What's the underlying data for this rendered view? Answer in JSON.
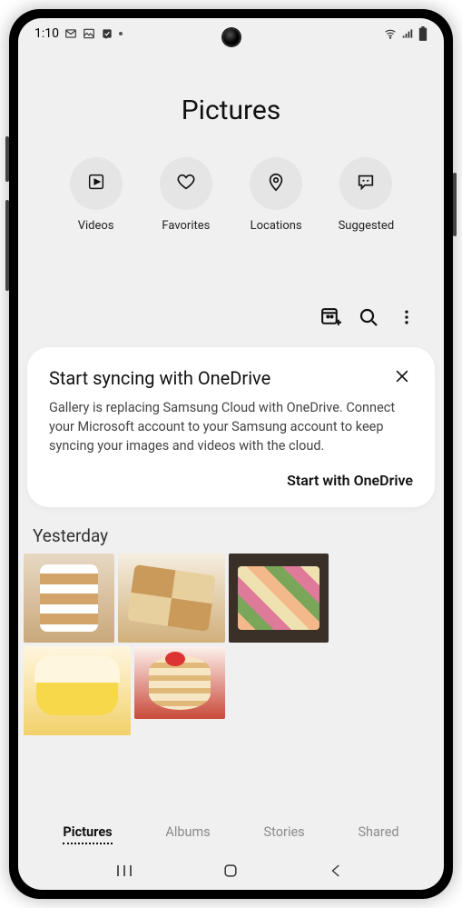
{
  "status": {
    "time": "1:10",
    "icons_left": [
      "gmail-icon",
      "image-icon",
      "check-icon"
    ],
    "icons_right": [
      "wifi-icon",
      "signal-icon",
      "battery-icon"
    ]
  },
  "header": {
    "title": "Pictures",
    "shortcuts": [
      {
        "icon": "play-icon",
        "label": "Videos"
      },
      {
        "icon": "heart-icon",
        "label": "Favorites"
      },
      {
        "icon": "pin-icon",
        "label": "Locations"
      },
      {
        "icon": "bubble-icon",
        "label": "Suggested"
      }
    ]
  },
  "actions": {
    "create": "create-gif-icon",
    "search": "search-icon",
    "more": "more-icon"
  },
  "card": {
    "title": "Start syncing with OneDrive",
    "body": "Gallery is replacing Samsung Cloud with OneDrive. Connect your Microsoft account to your Samsung account to keep syncing your images and videos with the cloud.",
    "action": "Start with OneDrive"
  },
  "sections": [
    {
      "label": "Yesterday",
      "thumb_count": 5
    }
  ],
  "tabs": [
    "Pictures",
    "Albums",
    "Stories",
    "Shared"
  ],
  "active_tab": "Pictures",
  "nav": [
    "recent-apps",
    "home",
    "back"
  ]
}
